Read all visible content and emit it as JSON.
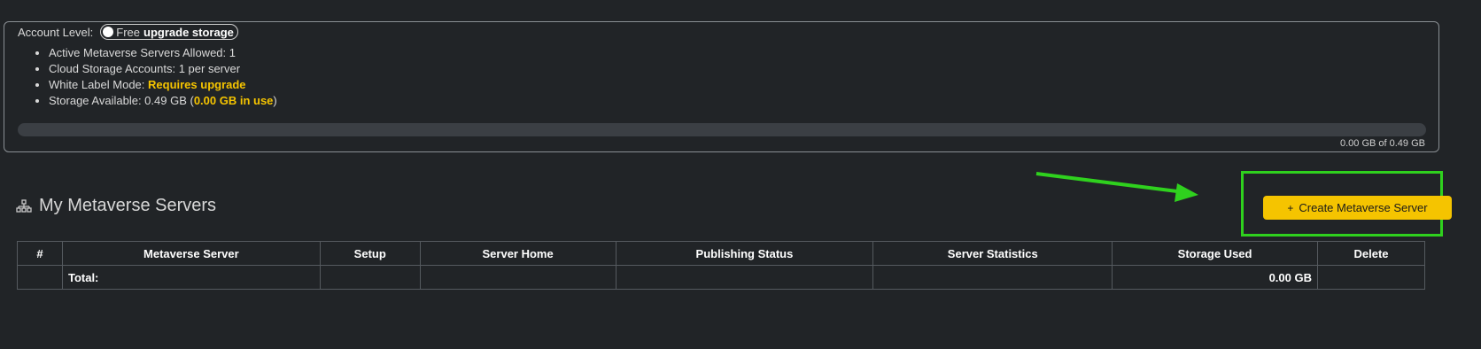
{
  "account": {
    "level_label": "Account Level:",
    "level_name": "Free",
    "upgrade_link": "upgrade storage",
    "features": [
      {
        "label": "Active Metaverse Servers Allowed: 1"
      },
      {
        "label": "Cloud Storage Accounts: 1 per server"
      },
      {
        "label": "White Label Mode: ",
        "highlight": "Requires upgrade"
      },
      {
        "label": "Storage Available: 0.49 GB (",
        "highlight": "0.00 GB in use",
        "suffix": ")"
      }
    ],
    "storage": {
      "used_fraction": 0,
      "readout": "0.00 GB of 0.49 GB"
    }
  },
  "servers_section": {
    "title": "My Metaverse Servers",
    "icon": "sitemap-icon",
    "create_button": {
      "icon": "plus-icon",
      "label": "Create Metaverse Server"
    }
  },
  "table": {
    "headers": [
      "#",
      "Metaverse Server",
      "Setup",
      "Server Home",
      "Publishing Status",
      "Server Statistics",
      "Storage Used",
      "Delete"
    ],
    "total_row": {
      "label": "Total:",
      "storage_used": "0.00 GB"
    }
  },
  "colors": {
    "background": "#212427",
    "accent": "#f5c400",
    "annotation": "#2fd11e"
  }
}
